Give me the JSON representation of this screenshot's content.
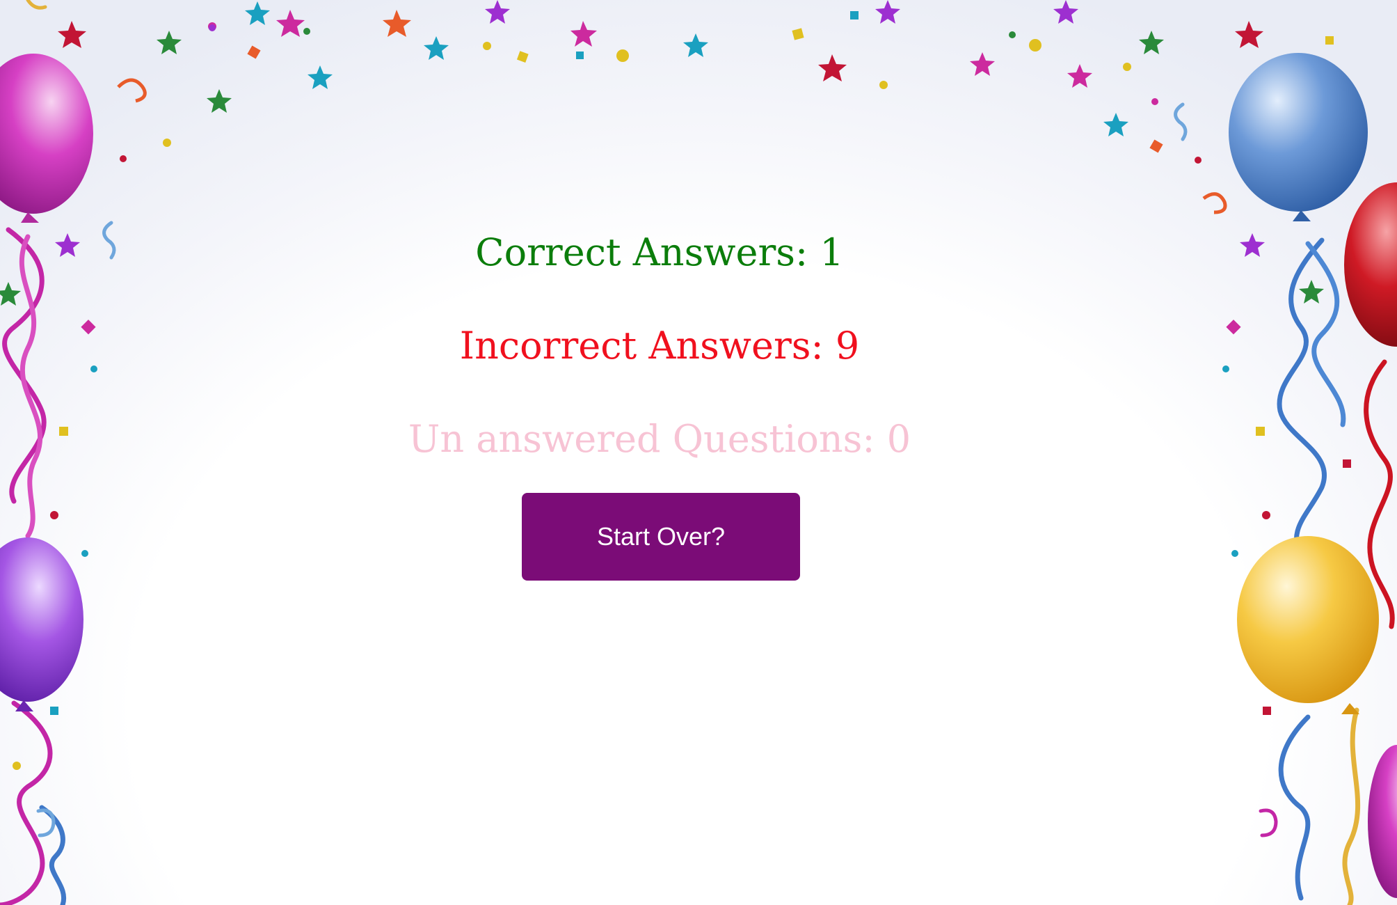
{
  "results": {
    "correct_label": "Correct Answers: 1",
    "incorrect_label": "Incorrect Answers: 9",
    "unanswered_label": "Un answered Questions: 0",
    "correct_count": 1,
    "incorrect_count": 9,
    "unanswered_count": 0
  },
  "start_over": {
    "label": "Start Over?"
  },
  "colors": {
    "correct": "#0b7d0b",
    "incorrect": "#f0101e",
    "unanswered": "#f7c3d4",
    "button_bg": "#7b0c77",
    "button_text": "#ffffff"
  },
  "background": {
    "balloon_colors": [
      "#cc33b8",
      "#9b44d8",
      "#4f86cc",
      "#c4151f",
      "#f3c030"
    ],
    "streamer_colors": [
      "#c326a6",
      "#3f78c8",
      "#e3b23a",
      "#cc1422"
    ],
    "confetti_colors": [
      "#e0c020",
      "#cc2a9e",
      "#1aa0c0",
      "#9d2fd0",
      "#e85b2a",
      "#2a8a3a",
      "#c21535"
    ]
  }
}
